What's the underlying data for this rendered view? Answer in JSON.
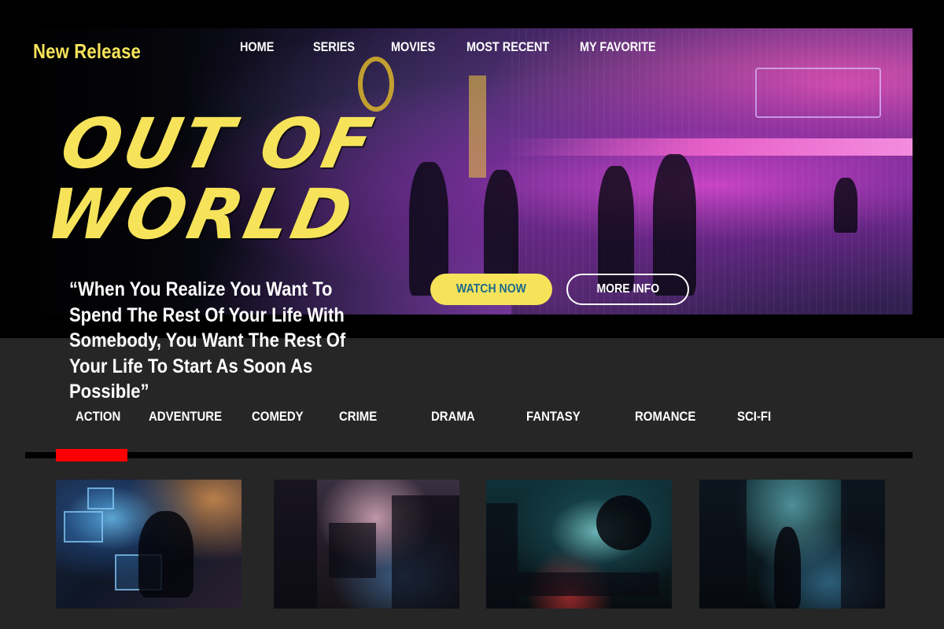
{
  "header": {
    "brand": "New Release",
    "nav": [
      "HOME",
      "SERIES",
      "MOVIES",
      "MOST RECENT",
      "MY FAVORITE"
    ]
  },
  "hero": {
    "title_lines": [
      "OUT OF",
      "WORLD"
    ],
    "quote": "“When You Realize You Want To Spend The Rest Of Your Life With Somebody, You Want The Rest Of Your Life To Start As Soon As Possible”",
    "watch_label": "WATCH NOW",
    "info_label": "MORE INFO"
  },
  "categories": {
    "items": [
      "ACTION",
      "ADVENTURE",
      "COMEDY",
      "CRIME",
      "DRAMA",
      "FANTASY",
      "ROMANCE",
      "SCI-FI"
    ],
    "active": "ACTION"
  },
  "colors": {
    "accent_yellow": "#f6e35a",
    "active_red": "#ff0000",
    "background": "#262626",
    "band": "#000000"
  },
  "thumbnails": [
    {
      "name": "hacker-scene-thumbnail"
    },
    {
      "name": "city-street-thumbnail"
    },
    {
      "name": "night-ship-thumbnail"
    },
    {
      "name": "rainy-alley-thumbnail"
    }
  ]
}
